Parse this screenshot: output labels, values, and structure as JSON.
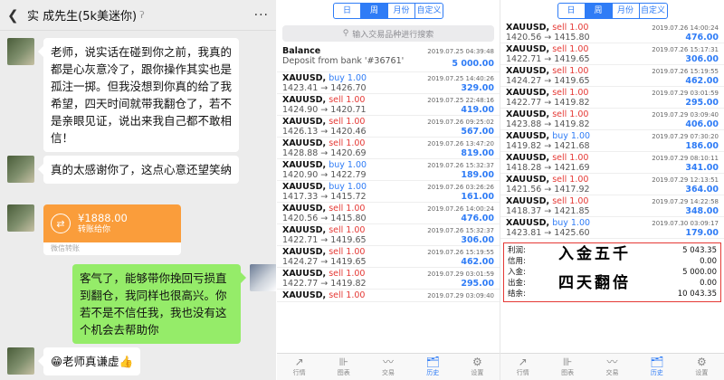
{
  "chat": {
    "title": "实  成先生(5k美迷你)",
    "messages": [
      {
        "text": "老师，说实话在碰到你之前，我真的都是心灰意冷了，跟你操作其实也是孤注一掷。但我没想到你真的给了我希望，四天时间就带我翻仓了，若不是亲眼见证，说出来我自己都不敢相信！"
      },
      {
        "text": "真的太感谢你了，这点心意还望笑纳"
      },
      {
        "amount": "¥1888.00",
        "note": "转账给你",
        "footer": "微信转账"
      },
      {
        "text": "客气了，能够带你挽回亏损直到翻仓，我同样也很高兴。你若不是不信任我，我也没有这个机会去帮助你"
      },
      {
        "text": "😁老师真谦虚👍"
      }
    ]
  },
  "tabs": [
    "日",
    "周",
    "月份",
    "自定义"
  ],
  "search_placeholder": "输入交易品种进行搜索",
  "history1": {
    "balance": {
      "label": "Balance",
      "detail": "Deposit from bank '#36761'",
      "date": "2019.07.25 04:39:48",
      "amount": "5 000.00"
    },
    "trades": [
      {
        "sym": "XAUUSD,",
        "side": "buy 1.00",
        "dir": "buy",
        "prices": "1423.41 → 1426.70",
        "date": "2019.07.25 14:40:26",
        "profit": "329.00"
      },
      {
        "sym": "XAUUSD,",
        "side": "sell 1.00",
        "dir": "sell",
        "prices": "1424.90 → 1420.71",
        "date": "2019.07.25 22:48:16",
        "profit": "419.00"
      },
      {
        "sym": "XAUUSD,",
        "side": "sell 1.00",
        "dir": "sell",
        "prices": "1426.13 → 1420.46",
        "date": "2019.07.26 09:25:02",
        "profit": "567.00"
      },
      {
        "sym": "XAUUSD,",
        "side": "sell 1.00",
        "dir": "sell",
        "prices": "1428.88 → 1420.69",
        "date": "2019.07.26 13:47:20",
        "profit": "819.00"
      },
      {
        "sym": "XAUUSD,",
        "side": "buy 1.00",
        "dir": "buy",
        "prices": "1420.90 → 1422.79",
        "date": "2019.07.26 15:32:37",
        "profit": "189.00"
      },
      {
        "sym": "XAUUSD,",
        "side": "buy 1.00",
        "dir": "buy",
        "prices": "1417.33 → 1415.72",
        "date": "2019.07.26 03:26:26",
        "profit": "161.00"
      },
      {
        "sym": "XAUUSD,",
        "side": "sell 1.00",
        "dir": "sell",
        "prices": "1420.56 → 1415.80",
        "date": "2019.07.26 14:00:24",
        "profit": "476.00"
      },
      {
        "sym": "XAUUSD,",
        "side": "sell 1.00",
        "dir": "sell",
        "prices": "1422.71 → 1419.65",
        "date": "2019.07.26 15:32:37",
        "profit": "306.00"
      },
      {
        "sym": "XAUUSD,",
        "side": "sell 1.00",
        "dir": "sell",
        "prices": "1424.27 → 1419.65",
        "date": "2019.07.26 15:19:55",
        "profit": "462.00"
      },
      {
        "sym": "XAUUSD,",
        "side": "sell 1.00",
        "dir": "sell",
        "prices": "1422.77 → 1419.82",
        "date": "2019.07.29 03:01:59",
        "profit": "295.00"
      }
    ],
    "partial": {
      "sym": "XAUUSD,",
      "side": "sell 1.00",
      "dir": "sell",
      "date": "2019.07.29 03:09:40"
    }
  },
  "history2": {
    "trades": [
      {
        "sym": "XAUUSD,",
        "side": "sell 1.00",
        "dir": "sell",
        "prices": "1420.56 → 1415.80",
        "date": "2019.07.26 14:00:24",
        "profit": "476.00"
      },
      {
        "sym": "XAUUSD,",
        "side": "sell 1.00",
        "dir": "sell",
        "prices": "1422.71 → 1419.65",
        "date": "2019.07.26 15:17:31",
        "profit": "306.00"
      },
      {
        "sym": "XAUUSD,",
        "side": "sell 1.00",
        "dir": "sell",
        "prices": "1424.27 → 1419.65",
        "date": "2019.07.26 15:19:55",
        "profit": "462.00"
      },
      {
        "sym": "XAUUSD,",
        "side": "sell 1.00",
        "dir": "sell",
        "prices": "1422.77 → 1419.82",
        "date": "2019.07.29 03:01:59",
        "profit": "295.00"
      },
      {
        "sym": "XAUUSD,",
        "side": "sell 1.00",
        "dir": "sell",
        "prices": "1423.88 → 1419.82",
        "date": "2019.07.29 03:09:40",
        "profit": "406.00"
      },
      {
        "sym": "XAUUSD,",
        "side": "buy 1.00",
        "dir": "buy",
        "prices": "1419.82 → 1421.68",
        "date": "2019.07.29 07:30:20",
        "profit": "186.00"
      },
      {
        "sym": "XAUUSD,",
        "side": "sell 1.00",
        "dir": "sell",
        "prices": "1418.28 → 1421.69",
        "date": "2019.07.29 08:10:11",
        "profit": "341.00"
      },
      {
        "sym": "XAUUSD,",
        "side": "sell 1.00",
        "dir": "sell",
        "prices": "1421.56 → 1417.92",
        "date": "2019.07.29 12:13:51",
        "profit": "364.00"
      },
      {
        "sym": "XAUUSD,",
        "side": "sell 1.00",
        "dir": "sell",
        "prices": "1418.37 → 1421.85",
        "date": "2019.07.29 14:22:58",
        "profit": "348.00"
      },
      {
        "sym": "XAUUSD,",
        "side": "buy 1.00",
        "dir": "buy",
        "prices": "1423.81 → 1425.60",
        "date": "2019.07.30 03:09:17",
        "profit": "179.00"
      }
    ],
    "summary": [
      {
        "label": "利润:",
        "value": "5 043.35"
      },
      {
        "label": "信用:",
        "value": "0.00"
      },
      {
        "label": "入金:",
        "value": "5 000.00"
      },
      {
        "label": "出金:",
        "value": "0.00"
      },
      {
        "label": "结余:",
        "value": "10 043.35"
      }
    ],
    "overlay": [
      "入金五千",
      "四天翻倍"
    ]
  },
  "nav": [
    {
      "icon": "↗",
      "label": "行情"
    },
    {
      "icon": "⊪",
      "label": "图表"
    },
    {
      "icon": "〰",
      "label": "交易"
    },
    {
      "icon": "🗂",
      "label": "历史"
    },
    {
      "icon": "⚙",
      "label": "设置"
    }
  ],
  "colors": {
    "buy": "#2f7cf6",
    "sell": "#e53935",
    "wechat_green": "#95ec69",
    "transfer_orange": "#fa9d3b"
  }
}
